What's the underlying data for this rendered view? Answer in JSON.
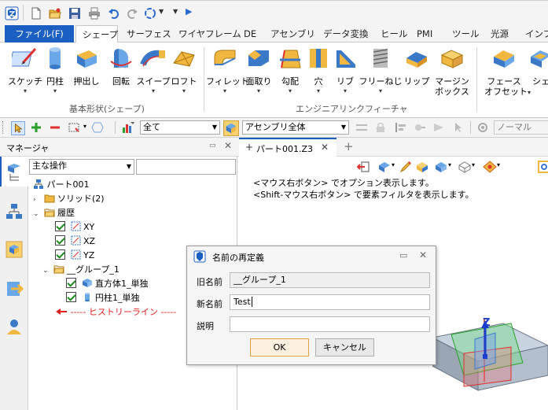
{
  "app": {
    "logo_icon": "zw3d-logo-icon"
  },
  "quick_access": {
    "icons": [
      "new-file-icon",
      "open-folder-icon",
      "save-icon",
      "print-icon",
      "undo-icon",
      "redo-icon",
      "rotate-view-icon",
      "customize-icon",
      "play-icon"
    ]
  },
  "ribbon_tabs": [
    {
      "label": "ファイル(F)"
    },
    {
      "label": "シェープ"
    },
    {
      "label": "サーフェス"
    },
    {
      "label": "ワイヤフレーム"
    },
    {
      "label": "DE"
    },
    {
      "label": "アセンブリ"
    },
    {
      "label": "データ変換"
    },
    {
      "label": "ヒール"
    },
    {
      "label": "PMI"
    },
    {
      "label": "ツール"
    },
    {
      "label": "光源"
    },
    {
      "label": "インフ"
    }
  ],
  "ribbon": {
    "basic_shape": {
      "group_label": "基本形状(シェープ)",
      "buttons": [
        {
          "label": "スケッチ",
          "icon": "sketch-icon"
        },
        {
          "label": "円柱",
          "icon": "cylinder-icon"
        },
        {
          "label": "押出し",
          "icon": "extrude-icon"
        },
        {
          "label": "回転",
          "icon": "revolve-icon"
        },
        {
          "label": "スイープ",
          "icon": "sweep-icon"
        },
        {
          "label": "ロフト",
          "icon": "loft-icon"
        }
      ]
    },
    "engineering": {
      "group_label": "エンジニアリンクフィーチャ",
      "buttons": [
        {
          "label": "フィレット",
          "icon": "fillet-icon"
        },
        {
          "label": "面取り",
          "icon": "chamfer-icon"
        },
        {
          "label": "勾配",
          "icon": "draft-icon"
        },
        {
          "label": "穴",
          "icon": "hole-icon"
        },
        {
          "label": "リブ",
          "icon": "rib-icon"
        },
        {
          "label": "フリーねじ",
          "icon": "thread-icon"
        },
        {
          "label": "リップ",
          "icon": "lip-icon"
        },
        {
          "label": "マージン",
          "label2": "ボックス",
          "icon": "margin-box-icon"
        }
      ]
    },
    "face": {
      "buttons": [
        {
          "label": "フェース",
          "label2": "オフセット",
          "icon": "face-offset-icon"
        },
        {
          "label": "シェ",
          "icon": "shell-icon"
        }
      ]
    }
  },
  "toolbar2": {
    "filter_select": "全て",
    "scope_select": "アセンブリ全体",
    "view_select": "ノーマル"
  },
  "manager": {
    "title": "マネージャ",
    "mode_select": "主な操作",
    "tree": {
      "root": "パート001",
      "solid": "ソリッド(2)",
      "history": "履歴",
      "xy": "XY",
      "xz": "XZ",
      "yz": "YZ",
      "group": "__グループ_1",
      "box": "直方体1_単独",
      "cylinder": "円柱1_単独",
      "history_line": "----- ヒストリーライン -----"
    }
  },
  "document": {
    "tab_label": "パート001.Z3",
    "hint_line1": "<マウス右ボタン> でオプション表示します。",
    "hint_line2": "<Shift-マウス右ボタン> で要素フィルタを表示します。",
    "axis_label": "Z"
  },
  "dialog": {
    "title": "名前の再定義",
    "old_name_label": "旧名前",
    "old_name_value": "__グループ_1",
    "new_name_label": "新名前",
    "new_name_value": "Test",
    "description_label": "説明",
    "description_value": "",
    "ok_label": "OK",
    "cancel_label": "キャンセル"
  },
  "colors": {
    "file_tab": "#1c5fc2",
    "history_line": "#e02020",
    "accent_orange": "#e0a040"
  }
}
